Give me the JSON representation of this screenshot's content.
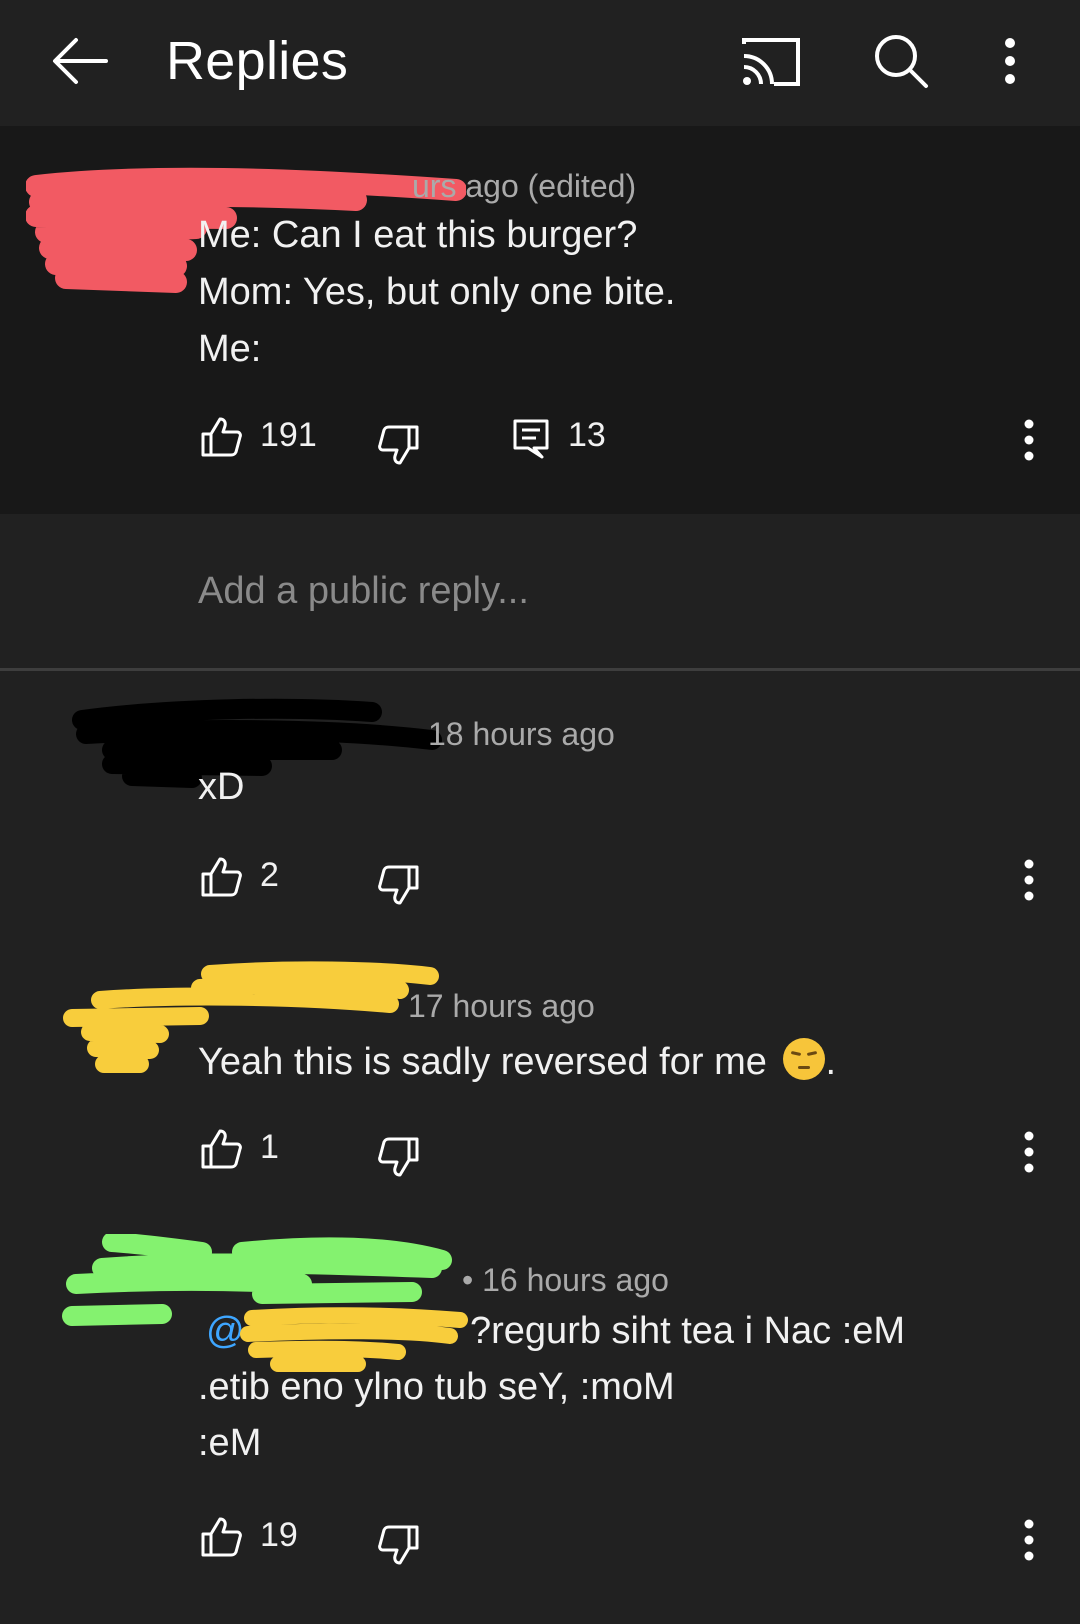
{
  "header": {
    "title": "Replies",
    "icons": [
      "back-arrow-icon",
      "cast-icon",
      "search-icon",
      "more-vert-icon"
    ]
  },
  "parent_comment": {
    "meta": "urs ago (edited)",
    "lines": [
      "Me: Can I eat this burger?",
      "Mom: Yes, but only one bite.",
      "Me:"
    ],
    "likes": "191",
    "replies": "13"
  },
  "reply_input": {
    "placeholder": "Add a public reply..."
  },
  "replies": [
    {
      "meta": "18 hours ago",
      "lines": [
        "xD"
      ],
      "likes": "2"
    },
    {
      "meta": "17 hours ago",
      "lines": [
        "Yeah this is sadly reversed for me",
        "."
      ],
      "likes": "1"
    },
    {
      "meta": "16 hours ago",
      "mention": "@",
      "lines": [
        "?regurb siht tea i Nac :eM",
        ".etib eno ylno tub seY, :moM",
        ":eM"
      ],
      "likes": "19"
    }
  ],
  "colors": {
    "background": "#212121",
    "parent_background": "#181818",
    "mention": "#3ea6ff",
    "redact_red": "#f25a63",
    "redact_yellow": "#f8cd3c",
    "redact_green": "#84f26f",
    "redact_black": "#000000"
  }
}
